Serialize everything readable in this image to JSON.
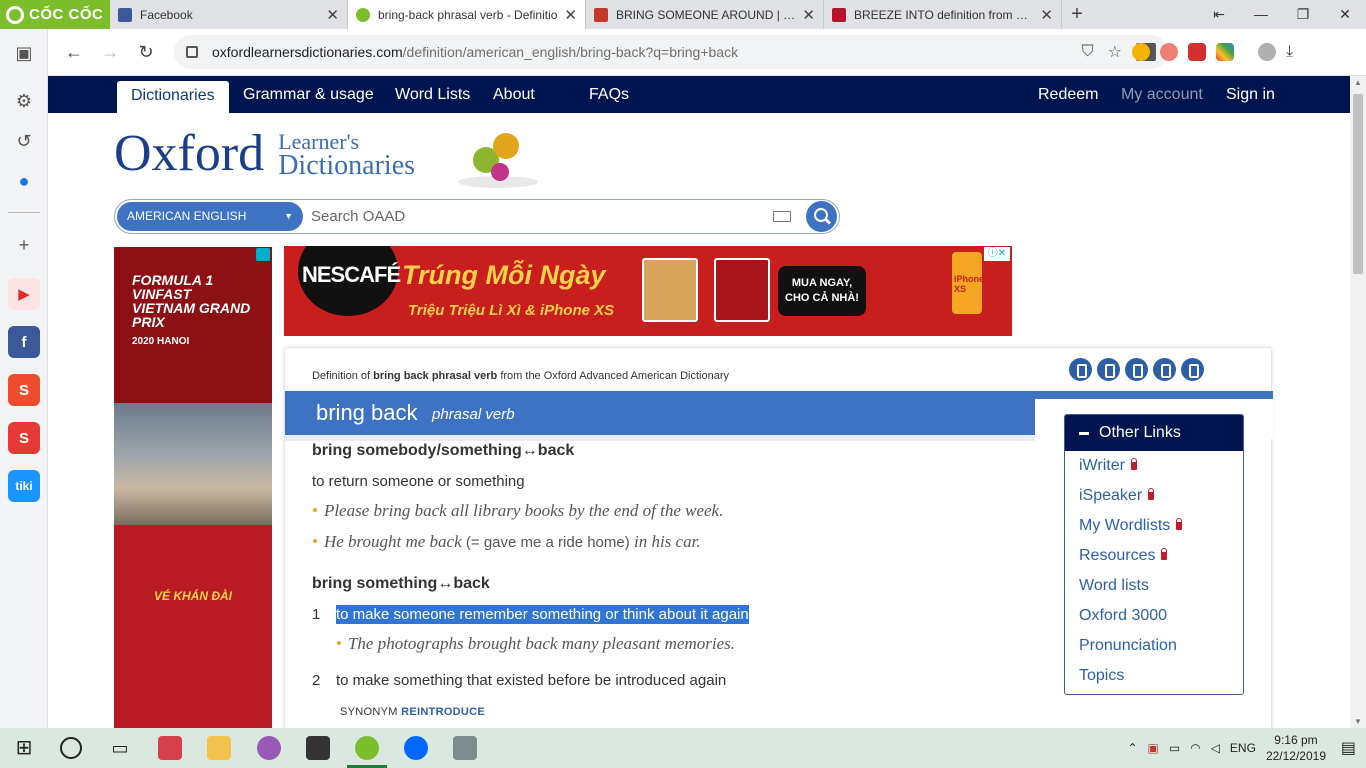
{
  "browser": {
    "brand": "CỐC CỐC",
    "tabs": [
      {
        "title": "Facebook",
        "color": "#3b5998"
      },
      {
        "title": "bring-back phrasal verb - Definitio",
        "color": "#7cbd2c"
      },
      {
        "title": "BRING SOMEONE AROUND | Định",
        "color": "#c0392b"
      },
      {
        "title": "BREEZE INTO definition from Mac",
        "color": "#b5122c"
      }
    ],
    "url_host": "oxfordlearnersdictionaries.com",
    "url_path": "/definition/american_english/bring-back?q=bring+back"
  },
  "nav": {
    "items": [
      "Dictionaries",
      "Grammar & usage",
      "Word Lists",
      "About",
      "FAQs"
    ],
    "right": [
      "Redeem",
      "My account",
      "Sign in"
    ]
  },
  "logo": {
    "oxford": "Oxford",
    "line1": "Learner's",
    "line2": "Dictionaries"
  },
  "search": {
    "language": "AMERICAN ENGLISH",
    "placeholder": "Search OAAD"
  },
  "ads": {
    "left_top": "FORMULA 1 VINFAST VIETNAM GRAND PRIX",
    "left_year": "2020",
    "left_city": "HANOI",
    "left_cta": "VÉ KHÁN ĐÀI",
    "top_brand": "NESCAFÉ",
    "top_headline": "Trúng Mỗi Ngày",
    "top_sub": "Triệu Triệu Lì Xì & iPhone XS",
    "top_bubble_1": "MUA NGAY,",
    "top_bubble_2": "CHO CẢ NHÀ!",
    "top_phone": "iPhone XS"
  },
  "entry": {
    "source_prefix": "Definition of",
    "source_bold": "bring back phrasal verb",
    "source_suffix": "from the Oxford Advanced American Dictionary",
    "headword": "bring back",
    "pos": "phrasal verb",
    "pattern1": "bring somebody/something↔back",
    "def1": "to return someone or something",
    "ex1": "Please bring back all library books by the end of the week.",
    "ex2_a": "He brought me back",
    "ex2_b": "(= gave me a ride home)",
    "ex2_c": "in his car.",
    "pattern2": "bring something↔back",
    "num1": "1",
    "def2": "to make someone remember something or think about it again",
    "ex3": "The photographs brought back many pleasant memories.",
    "num2": "2",
    "def3": "to make something that existed before be introduced again",
    "syn_label": "SYNONYM",
    "syn_word": "REINTRODUCE"
  },
  "other_links": {
    "title": "Other Links",
    "items": [
      "iWriter",
      "iSpeaker",
      "My Wordlists",
      "Resources",
      "Word lists",
      "Oxford 3000",
      "Pronunciation",
      "Topics"
    ]
  },
  "taskbar": {
    "lang": "ENG",
    "time": "9:16 pm",
    "date": "22/12/2019"
  }
}
